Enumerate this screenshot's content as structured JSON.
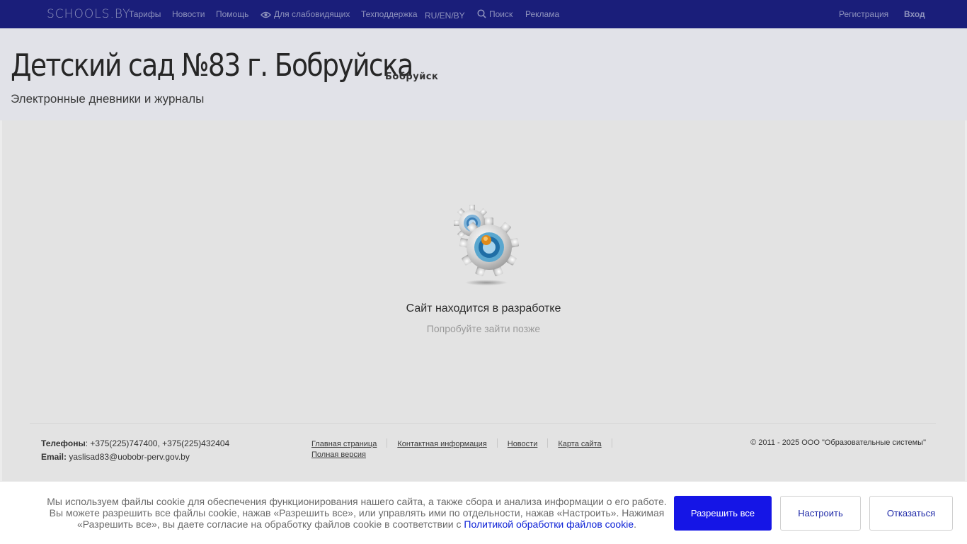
{
  "nav": {
    "logo": "SCHOOLS.BY",
    "items": [
      "Тарифы",
      "Новости",
      "Помощь",
      "Для слабовидящих",
      "Техподдержка",
      "RU/EN/BY",
      "Поиск",
      "Реклама"
    ],
    "register": "Регистрация",
    "login": "Вход"
  },
  "header": {
    "title": "Детский сад №83 г. Бобруйска",
    "city": "Бобруйск",
    "subtitle": "Электронные дневники и журналы"
  },
  "main": {
    "message": "Сайт находится в разработке",
    "submessage": "Попробуйте зайти позже"
  },
  "footer": {
    "phones_label": "Телефоны",
    "phones_value": ": +375(225)747400, +375(225)432404",
    "email_label": "Email:",
    "email_value": " yaslisad83@uobobr-perv.gov.by",
    "links": [
      "Главная страница",
      "Контактная информация",
      "Новости",
      "Карта сайта",
      "Полная версия"
    ],
    "copyright": "© 2011 - 2025 ООО \"Образовательные системы\""
  },
  "cookie": {
    "text": "Мы используем файлы cookie для обеспечения функционирования нашего сайта, а также сбора и анализа информации о его работе. Вы можете разрешить все файлы cookie, нажав «Разрешить все», или управлять ими по отдельности, нажав «Настроить». Нажимая «Разрешить все», вы даете согласие на обработку файлов cookie в соответствии с ",
    "policy_link": "Политикой обработки файлов cookie",
    "text_end": ".",
    "allow_all": "Разрешить все",
    "configure": "Настроить",
    "deny": "Отказаться"
  }
}
